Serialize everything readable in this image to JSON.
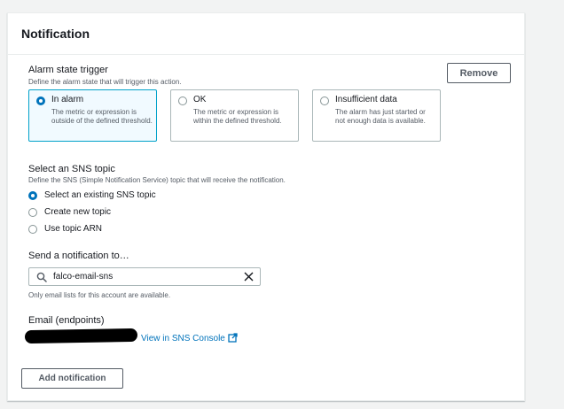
{
  "panel": {
    "title": "Notification",
    "remove_label": "Remove"
  },
  "alarm_trigger": {
    "label": "Alarm state trigger",
    "description": "Define the alarm state that will trigger this action.",
    "options": [
      {
        "title": "In alarm",
        "description": "The metric or expression is outside of the defined threshold.",
        "selected": true
      },
      {
        "title": "OK",
        "description": "The metric or expression is within the defined threshold.",
        "selected": false
      },
      {
        "title": "Insufficient data",
        "description": "The alarm has just started or not enough data is available.",
        "selected": false
      }
    ]
  },
  "sns_topic": {
    "label": "Select an SNS topic",
    "description": "Define the SNS (Simple Notification Service) topic that will receive the notification.",
    "options": [
      {
        "label": "Select an existing SNS topic",
        "selected": true
      },
      {
        "label": "Create new topic",
        "selected": false
      },
      {
        "label": "Use topic ARN",
        "selected": false
      }
    ]
  },
  "send_to": {
    "label": "Send a notification to…",
    "value": "falco-email-sns",
    "hint": "Only email lists for this account are available."
  },
  "email": {
    "label": "Email (endpoints)",
    "link_label": "View in SNS Console"
  },
  "add_notification_label": "Add notification",
  "colors": {
    "accent": "#0073bb",
    "tile_selected_border": "#00a1c9",
    "tile_selected_bg": "#f1faff"
  },
  "icons": {
    "search": "search-icon",
    "clear": "close-icon",
    "external": "external-link-icon"
  }
}
